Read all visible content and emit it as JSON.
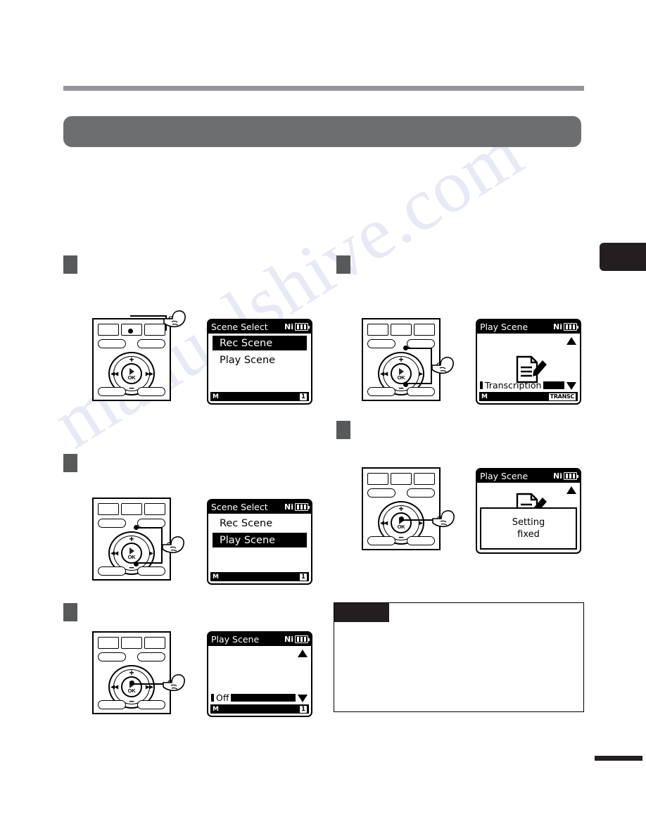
{
  "page": {
    "watermark": "manualshive.com",
    "title_bar_text": "",
    "thumb_tab": "",
    "footer_mark": ""
  },
  "steps": [
    {
      "marker": "",
      "device": {
        "name": "voice-recorder",
        "press_target": "menu-button",
        "dial": {
          "plus": "+",
          "minus": "−",
          "prev": "◀◀",
          "next": "▶▶",
          "ok": "OK"
        }
      },
      "lcd": {
        "title": "Scene Select",
        "battery_label": "Ni",
        "menu": [
          {
            "label": "Rec Scene",
            "selected": true
          },
          {
            "label": "Play Scene",
            "selected": false
          }
        ],
        "status_left": "M",
        "status_right": "1"
      }
    },
    {
      "marker": "",
      "device": {
        "name": "voice-recorder",
        "press_target": "plus-minus-buttons",
        "dial": {
          "plus": "+",
          "minus": "−",
          "prev": "◀◀",
          "next": "▶",
          "ok": "OK"
        }
      },
      "lcd": {
        "title": "Play Scene",
        "battery_label": "Ni",
        "icon": "document-pencil-icon",
        "bottom_item": "Transcription",
        "status_left": "M",
        "status_transc": "TRANSC",
        "arrow_up": true,
        "arrow_down": true
      }
    },
    {
      "marker": "",
      "device": {
        "name": "voice-recorder",
        "press_target": "plus-minus-buttons",
        "dial": {
          "plus": "+",
          "minus": "−",
          "prev": "◀◀",
          "next": "▶",
          "ok": "OK"
        }
      },
      "lcd": {
        "title": "Scene Select",
        "battery_label": "Ni",
        "menu": [
          {
            "label": "Rec Scene",
            "selected": false
          },
          {
            "label": "Play Scene",
            "selected": true
          }
        ],
        "status_left": "M",
        "status_right": "1"
      }
    },
    {
      "marker": "",
      "device": {
        "name": "voice-recorder",
        "press_target": "ok-button",
        "dial": {
          "plus": "+",
          "minus": "−",
          "prev": "◀◀",
          "next": "▶",
          "ok": "OK"
        }
      },
      "lcd": {
        "title": "Play Scene",
        "battery_label": "Ni",
        "icon": "document-pencil-icon",
        "confirm_line1": "Setting",
        "confirm_line2": "fixed",
        "arrow_up": true
      }
    },
    {
      "marker": "",
      "device": {
        "name": "voice-recorder",
        "press_target": "ok-button",
        "dial": {
          "plus": "+",
          "minus": "−",
          "prev": "◀◀",
          "next": "▶▶",
          "ok": "OK"
        }
      },
      "lcd": {
        "title": "Play Scene",
        "battery_label": "Ni",
        "bottom_item": "Off",
        "status_left": "M",
        "status_right": "1",
        "arrow_up": true,
        "arrow_down": true
      }
    }
  ],
  "note": {
    "tab_label": "",
    "body": ""
  }
}
